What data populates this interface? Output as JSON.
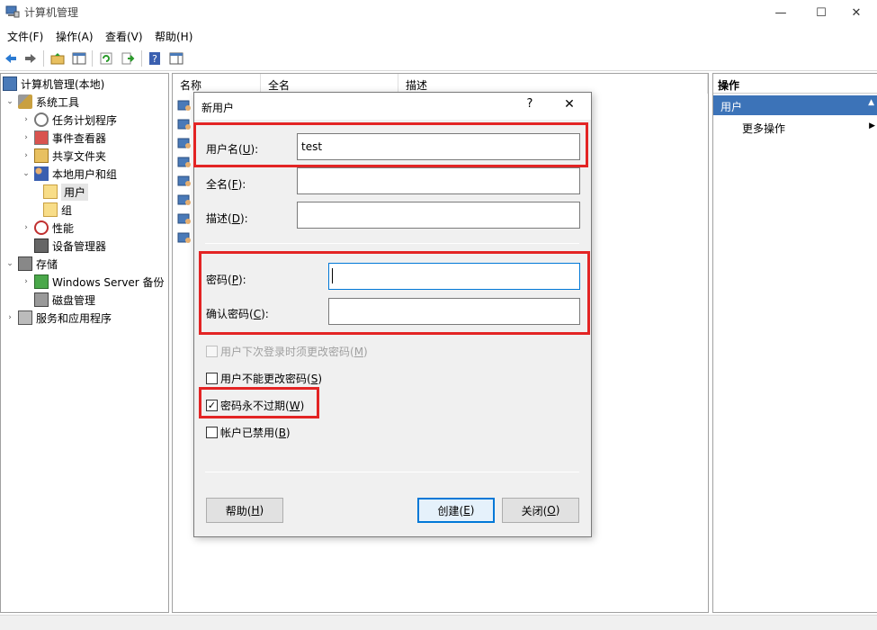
{
  "window": {
    "title": "计算机管理",
    "minimize": "—",
    "maximize": "☐",
    "close": "✕"
  },
  "menu": [
    "文件(F)",
    "操作(A)",
    "查看(V)",
    "帮助(H)"
  ],
  "tree": {
    "root": "计算机管理(本地)",
    "system_tools": "系统工具",
    "task_scheduler": "任务计划程序",
    "event_viewer": "事件查看器",
    "shared_folders": "共享文件夹",
    "local_users_groups": "本地用户和组",
    "users": "用户",
    "groups": "组",
    "performance": "性能",
    "device_manager": "设备管理器",
    "storage": "存储",
    "windows_server_backup": "Windows Server 备份",
    "disk_management": "磁盘管理",
    "services_apps": "服务和应用程序"
  },
  "columns": {
    "name": "名称",
    "fullname": "全名",
    "description": "描述"
  },
  "actions": {
    "header": "操作",
    "section": "用户",
    "more": "更多操作"
  },
  "dialog": {
    "title": "新用户",
    "help_glyph": "?",
    "close_glyph": "✕",
    "username_label": "用户名(",
    "username_key": "U",
    "username_suffix": "):",
    "username_value": "test",
    "fullname_label": "全名(",
    "fullname_key": "F",
    "fullname_suffix": "):",
    "desc_label": "描述(",
    "desc_key": "D",
    "desc_suffix": "):",
    "password_label": "密码(",
    "password_key": "P",
    "password_suffix": "):",
    "confirm_label": "确认密码(",
    "confirm_key": "C",
    "confirm_suffix": "):",
    "chk_must_change": "用户下次登录时须更改密码(",
    "chk_must_change_key": "M",
    "chk_cannot_change": "用户不能更改密码(",
    "chk_cannot_change_key": "S",
    "chk_never_expires": "密码永不过期(",
    "chk_never_expires_key": "W",
    "chk_disabled": "帐户已禁用(",
    "chk_disabled_key": "B",
    "close_paren": ")",
    "checkmark": "✓",
    "btn_help": "帮助(",
    "btn_help_key": "H",
    "btn_create": "创建(",
    "btn_create_key": "E",
    "btn_close": "关闭(",
    "btn_close_key": "O"
  },
  "colors": {
    "highlight": "#e32424",
    "accent": "#0078d7",
    "section_blue": "#3c73b8"
  }
}
